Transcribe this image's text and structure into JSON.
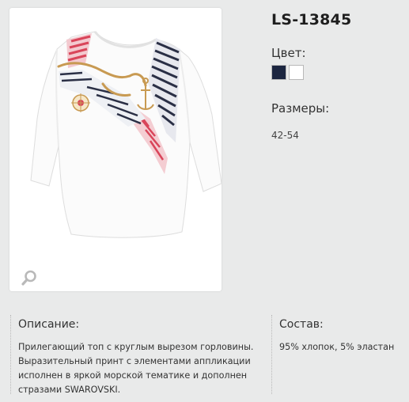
{
  "product": {
    "sku": "LS-13845",
    "color_label": "Цвет:",
    "colors": [
      {
        "name": "navy",
        "hex": "#1c2640"
      },
      {
        "name": "white",
        "hex": "#ffffff"
      }
    ],
    "sizes_label": "Размеры:",
    "sizes_value": "42-54"
  },
  "description": {
    "title": "Описание:",
    "text": "Прилегающий топ с круглым вырезом горловины.\nВыразительный  принт с элементами аппликации\nисполнен в яркой морской тематике  и дополнен\nстразами SWAROVSKI."
  },
  "composition": {
    "title": "Состав:",
    "text": "95% хлопок, 5% эластан"
  },
  "icons": {
    "zoom": "magnifier-icon"
  },
  "colors_theme": {
    "background": "#e9eaea",
    "card": "#ffffff",
    "print_red": "#d9455a",
    "print_navy": "#2a2f45",
    "print_gold": "#c89a52"
  }
}
